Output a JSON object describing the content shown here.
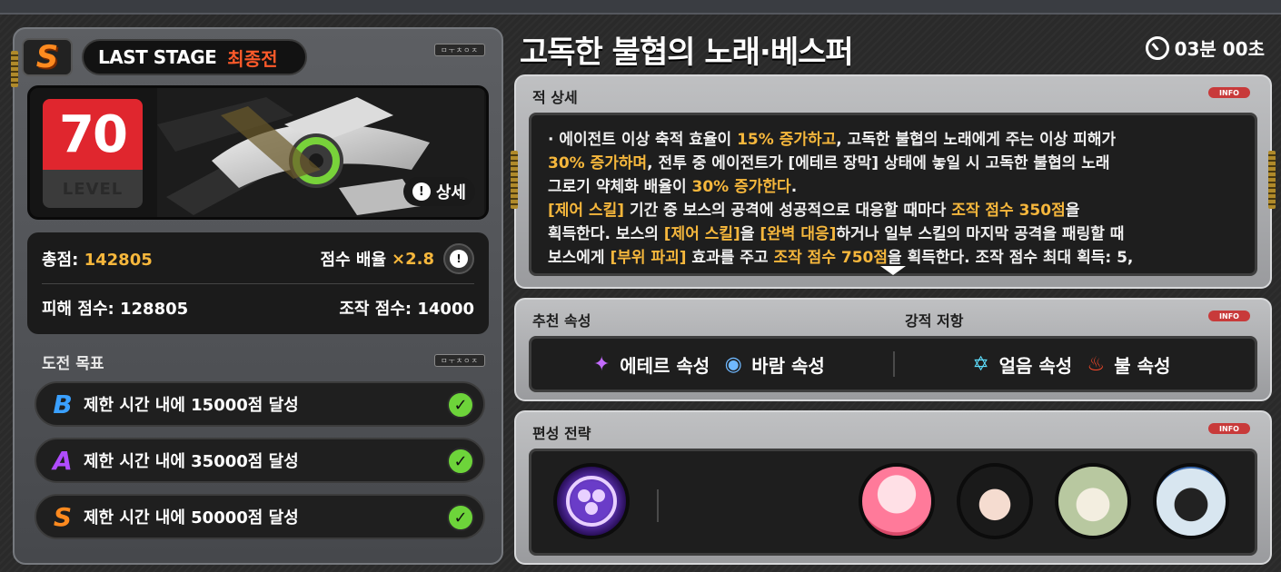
{
  "stage": {
    "grade_badge": "S",
    "label_en": "LAST STAGE",
    "label_ko": "최종전",
    "small_tag": "ㅁㅜㅊㅇㅈ"
  },
  "boss": {
    "level_value": "70",
    "level_label": "LEVEL",
    "detail_button": "상세",
    "detail_icon": "info-circle-icon"
  },
  "scores": {
    "total_label": "총점:",
    "total_value": "142805",
    "multiplier_label": "점수 배율",
    "multiplier_value": "×2.8",
    "damage_label": "피해 점수:",
    "damage_value": "128805",
    "operation_label": "조작 점수:",
    "operation_value": "14000"
  },
  "challenges": {
    "title": "도전 목표",
    "tag": "ㅁㅜㅊㅇㅈ",
    "items": [
      {
        "grade": "B",
        "text": "제한 시간 내에 15000점 달성",
        "color": "#3aa0ff",
        "done": true
      },
      {
        "grade": "A",
        "text": "제한 시간 내에 35000점 달성",
        "color": "#b04cff",
        "done": true
      },
      {
        "grade": "S",
        "text": "제한 시간 내에 50000점 달성",
        "color": "#ff8a1f",
        "done": true
      }
    ]
  },
  "header": {
    "boss_name": "고독한 불협의 노래·베스퍼",
    "timer": "03분 00초"
  },
  "enemy_detail": {
    "title": "적 상세",
    "info_badge": "INFO",
    "line1_a": "· 에이전트 이상 축적 효율이 ",
    "line1_b": "15% 증가하고",
    "line1_c": ", 고독한 불협의 노래에게 주는 이상 피해가",
    "line2_a": "30% 증가하며",
    "line2_b": ", 전투 중 에이전트가 [에테르 장막] 상태에 놓일 시 고독한 불협의 노래",
    "line3_a": "그로기 약체화 배율이 ",
    "line3_b": "30% 증가한다",
    "line3_c": ".",
    "line4_a": "[제어 스킬]",
    "line4_b": " 기간 중 보스의 공격에 성공적으로 대응할 때마다 ",
    "line4_c": "조작 점수 350점",
    "line4_d": "을",
    "line5_a": "획득한다. 보스의 ",
    "line5_b": "[제어 스킬]",
    "line5_c": "을 ",
    "line5_d": "[완벽 대응]",
    "line5_e": "하거나 일부 스킬의 마지막 공격을 패링할 때",
    "line6_a": "보스에게 ",
    "line6_b": "[부위 파괴]",
    "line6_c": " 효과를 주고 ",
    "line6_d": "조작 점수 750점",
    "line6_e": "을 획득한다. 조작 점수 최대 획득: 5,"
  },
  "attributes": {
    "recommended_title": "추천 속성",
    "resist_title": "강적 저항",
    "info_badge": "INFO",
    "recommended": [
      {
        "icon": "ether-sparkle-icon",
        "label": "에테르 속성",
        "color": "#c46bff"
      },
      {
        "icon": "wind-swirl-icon",
        "label": "바람 속성",
        "color": "#6fb8ff"
      }
    ],
    "resist": [
      {
        "icon": "ice-star-icon",
        "label": "얼음 속성",
        "color": "#5ee0ff"
      },
      {
        "icon": "fire-icon",
        "label": "불 속성",
        "color": "#ff4a2a"
      }
    ]
  },
  "formation": {
    "title": "편성 전략",
    "info_badge": "INFO",
    "bangboo_icon": "bangboo-emblem-icon",
    "agents": [
      "agent-portrait-pink-hair",
      "agent-portrait-black-hair",
      "agent-portrait-green-hair",
      "agent-portrait-robot"
    ]
  },
  "colors": {
    "accent_gold": "#f6b73c",
    "level_red": "#e0262e",
    "check_green": "#6dd43a"
  }
}
